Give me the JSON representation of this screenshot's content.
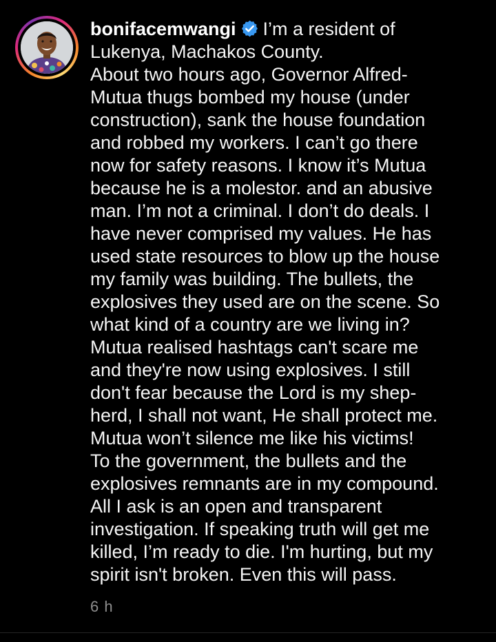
{
  "post": {
    "username": "bonifacemwangi",
    "verified_icon": "verified-badge-icon",
    "caption_first": "I’m a resident of",
    "caption_lines": [
      "Lukenya, Machakos County.",
      "About two hours ago, Governor Alfred-",
      "Mutua thugs bombed my house (under",
      "construction), sank the house foundation",
      "and robbed my workers. I can’t go there",
      "now for safety reasons. I know it’s Mutua",
      "because he is a molestor. and an abusive",
      "man. I’m not a criminal. I don’t do deals. I",
      "have never comprised my values. He has",
      "used state resources to blow up the house",
      "my family was building. The bullets, the",
      "explosives they used are on the scene. So",
      "what kind of a country are we living in?",
      "Mutua realised hashtags can't scare me",
      "and they're now using explosives. I still",
      "don't fear because the Lord is my shep-",
      "herd, I shall not want, He shall protect me.",
      "Mutua won’t silence me like his victims!",
      "To the government, the bullets and the",
      "explosives remnants are in my compound.",
      "All I ask is an open and transparent",
      "investigation. If speaking truth will get me",
      "killed, I’m ready to die. I'm hurting, but my",
      "spirit isn't broken. Even this will pass."
    ],
    "timestamp": "6 h"
  },
  "colors": {
    "background": "#000000",
    "text": "#f5f5f5",
    "muted": "#8e8e8e",
    "verified_blue": "#3897f0"
  }
}
